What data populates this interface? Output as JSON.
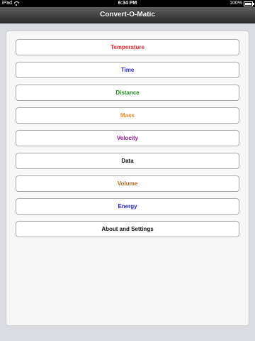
{
  "status_bar": {
    "carrier": "iPad",
    "time": "6:34 PM",
    "battery": "100%"
  },
  "nav": {
    "title": "Convert-O-Matic"
  },
  "menu": {
    "items": [
      {
        "label": "Temperature",
        "color": "#e8262c"
      },
      {
        "label": "Time",
        "color": "#1f1fcc"
      },
      {
        "label": "Distance",
        "color": "#1f8a1f"
      },
      {
        "label": "Mass",
        "color": "#f08a24"
      },
      {
        "label": "Velocity",
        "color": "#8b1a96"
      },
      {
        "label": "Data",
        "color": "#111111"
      },
      {
        "label": "Volume",
        "color": "#b56a1f"
      },
      {
        "label": "Energy",
        "color": "#1f1fcc"
      },
      {
        "label": "About and Settings",
        "color": "#111111"
      }
    ]
  }
}
